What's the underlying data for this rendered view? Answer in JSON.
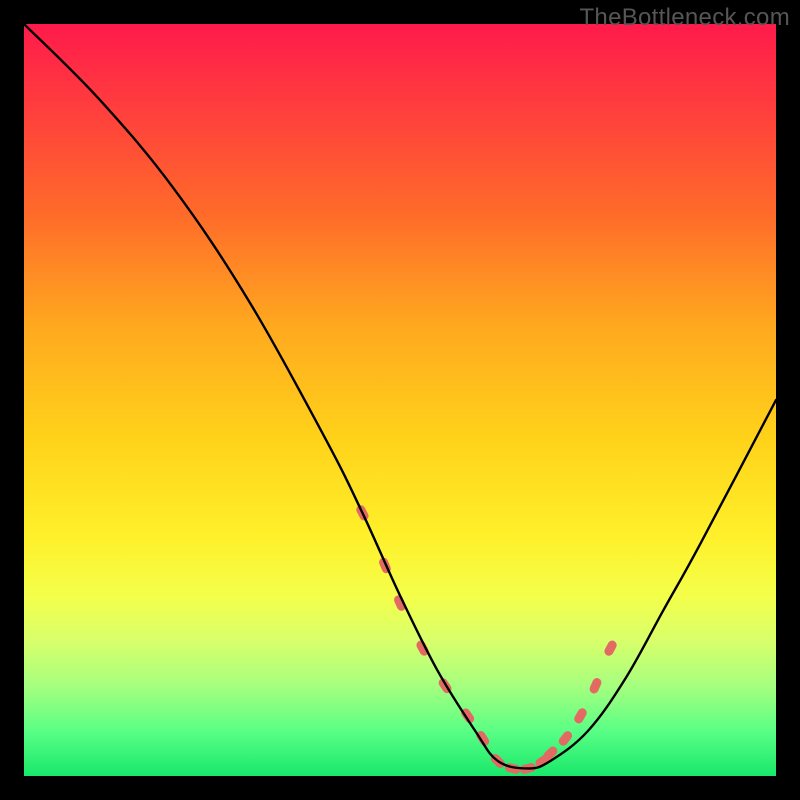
{
  "watermark": "TheBottleneck.com",
  "chart_data": {
    "type": "line",
    "title": "",
    "xlabel": "",
    "ylabel": "",
    "xlim": [
      0,
      100
    ],
    "ylim": [
      0,
      100
    ],
    "series": [
      {
        "name": "bottleneck-curve",
        "x": [
          0,
          10,
          20,
          30,
          40,
          45,
          50,
          55,
          60,
          63,
          67,
          70,
          75,
          80,
          85,
          90,
          100
        ],
        "values": [
          100,
          90,
          78,
          63,
          45,
          35,
          24,
          14,
          6,
          2,
          1,
          2,
          6,
          13,
          22,
          31,
          50
        ]
      }
    ],
    "markers": {
      "name": "highlight-dots",
      "color": "#e36a63",
      "x": [
        45,
        48,
        50,
        53,
        56,
        59,
        61,
        63,
        65,
        67,
        69,
        70,
        72,
        74,
        76,
        78
      ],
      "values": [
        35,
        28,
        23,
        17,
        12,
        8,
        5,
        2,
        1,
        1,
        2,
        3,
        5,
        8,
        12,
        17
      ]
    }
  }
}
